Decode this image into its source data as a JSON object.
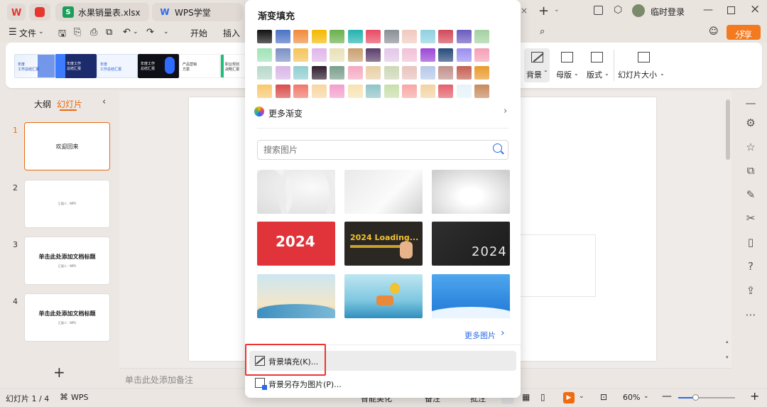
{
  "titlebar": {
    "tabs": [
      {
        "label": "水果销量表.xlsx",
        "icon": "spreadsheet-icon",
        "color": "#1a9e5a"
      },
      {
        "label": "WPS学堂",
        "icon": "wps-academy-icon",
        "color": "#2a6bea"
      }
    ],
    "login_label": "临时登录"
  },
  "menubar": {
    "file_label": "文件",
    "items": [
      "开始",
      "插入"
    ],
    "share_label": "分享"
  },
  "ribbon": {
    "templates": [
      {
        "line1": "年度",
        "line2": "工作总结汇报"
      },
      {
        "line1": "年度工作",
        "line2": "总结汇报"
      },
      {
        "line1": "年度",
        "line2": "工作总结汇报"
      },
      {
        "line1": "年度工作",
        "line2": "总结汇报"
      },
      {
        "line1": "产品营销",
        "line2": "方案"
      },
      {
        "line1": "职业规划",
        "line2": "战略汇报"
      }
    ],
    "buttons": [
      {
        "label": "背景",
        "icon": "background-icon"
      },
      {
        "label": "母版",
        "icon": "master-icon"
      },
      {
        "label": "版式",
        "icon": "layout-icon"
      },
      {
        "label": "幻灯片大小",
        "icon": "slide-size-icon"
      }
    ]
  },
  "leftpanel": {
    "tab_outline": "大纲",
    "tab_slides": "幻灯片",
    "slides": [
      {
        "num": "1",
        "title": "欢迎回来",
        "sub": ""
      },
      {
        "num": "2",
        "title": "",
        "sub": "汇报人：WPS"
      },
      {
        "num": "3",
        "title": "单击此处添加文档标题",
        "sub": "汇报人：WPS"
      },
      {
        "num": "4",
        "title": "单击此处添加文档标题",
        "sub": "汇报人：WPS"
      }
    ]
  },
  "canvas": {
    "notes_placeholder": "单击此处添加备注"
  },
  "popup": {
    "title": "渐变填充",
    "more_gradients": "更多渐变",
    "search_placeholder": "搜索图片",
    "images": [
      {
        "caption": ""
      },
      {
        "caption": ""
      },
      {
        "caption": ""
      },
      {
        "caption": "2024"
      },
      {
        "caption": "2024 Loading..."
      },
      {
        "caption": "2024"
      },
      {
        "caption": ""
      },
      {
        "caption": ""
      },
      {
        "caption": ""
      }
    ],
    "more_images": "更多图片",
    "background_fill": "背景填充(K)...",
    "save_background": "背景另存为图片(P)..."
  },
  "statusbar": {
    "slide_counter": "幻灯片 1 / 4",
    "theme_label": "WPS",
    "smart_label": "智能美化",
    "notes_label": "备注",
    "comment_label": "批注",
    "zoom": "60%"
  },
  "colors": {
    "accent": "#f07b1e",
    "share_bg": "#f47a20",
    "highlight": "#e33333",
    "wps_red": "#e8362f"
  },
  "swatches": [
    [
      "#111111",
      "#4a72c4",
      "#f08a3c",
      "#f5b800",
      "#6ab04c",
      "#22b3b0",
      "#e84a63",
      "#8a8f96",
      "#f0c9bf",
      "#8fd0e0",
      "#d2495b",
      "#6a5bbf",
      "#a2d1a2"
    ],
    [
      "#9fe3b5",
      "#7a8fc4",
      "#f5c35a",
      "#e1b5e8",
      "#e9e0b8",
      "#c9a06f",
      "#5b3d6b",
      "#e2c7e8",
      "#f2c0d7",
      "#9b47d6",
      "#274a7c",
      "#9a8df0",
      "#f4a0b5"
    ],
    [
      "#b6d8c9",
      "#d7b6e6",
      "#8fcdd0",
      "#2e1c2f",
      "#7a9e8c",
      "#f4a9c2",
      "#e7cfa5",
      "#ccd7b6",
      "#e8c3bd",
      "#b6c9e8",
      "#c08f8a",
      "#c46050",
      "#e99a2b"
    ],
    [
      "#f9c86e",
      "#d94c4c",
      "#f0786a",
      "#f7d6a2",
      "#f29ecb",
      "#f7e3b2",
      "#8ec4c8",
      "#c8dfaa",
      "#f7a7a3",
      "#f2d3a2",
      "#e45f6c",
      "#e5f3f8",
      "#c78a5e"
    ]
  ]
}
